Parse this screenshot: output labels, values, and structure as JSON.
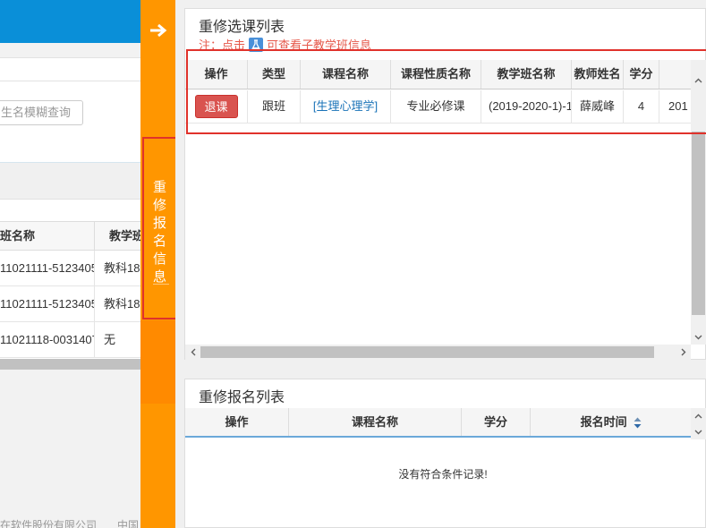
{
  "background_page": {
    "search_placeholder": "生名模糊查询",
    "table": {
      "headers": [
        "班名称",
        "教学班"
      ],
      "rows": [
        [
          "11021111-5123405",
          "教科18"
        ],
        [
          "11021111-5123405",
          "教科18"
        ],
        [
          "11021118-0031407",
          "无"
        ]
      ]
    },
    "footer": [
      "在软件股份有限公司",
      "中国"
    ]
  },
  "side_tab": {
    "label": "重修报名信息",
    "arrow_icon": "arrow-right-icon"
  },
  "retake_selected_list": {
    "title": "重修选课列表",
    "note_prefix": "注：点击",
    "note_suffix": "可查看子教学班信息",
    "columns": [
      "操作",
      "类型",
      "课程名称",
      "课程性质名称",
      "教学班名称",
      "教师姓名",
      "学分",
      ""
    ],
    "rows": [
      {
        "action": "退课",
        "type": "跟班",
        "course_name": "[生理心理学]",
        "course_nature": "专业必修课",
        "class_name": "(2019-2020-1)-1",
        "teacher": "薛威峰",
        "credits": "4",
        "extra": "201"
      }
    ]
  },
  "retake_signup_list": {
    "title": "重修报名列表",
    "columns": [
      "操作",
      "课程名称",
      "学分",
      "报名时间"
    ],
    "empty_message": "没有符合条件记录!"
  },
  "colors": {
    "side_orange": "#ff9600",
    "danger": "#d9534f",
    "highlight": "#e0322b",
    "link": "#1a73b8"
  }
}
